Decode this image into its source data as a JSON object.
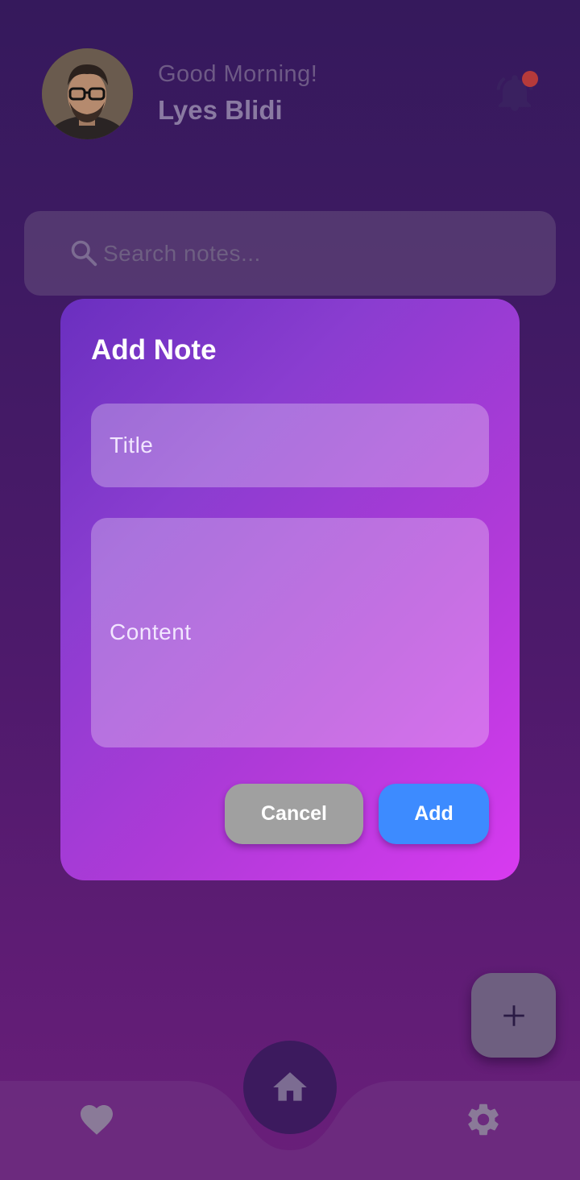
{
  "header": {
    "greeting": "Good Morning!",
    "user_name": "Lyes Blidi",
    "avatar_icon": "avatar-photo",
    "notification_icon": "bell-icon"
  },
  "search": {
    "placeholder": "Search notes...",
    "icon": "search-icon"
  },
  "dialog": {
    "title": "Add Note",
    "title_placeholder": "Title",
    "content_placeholder": "Content",
    "cancel_label": "Cancel",
    "add_label": "Add",
    "colors": {
      "gradient_start": "#6a2fbf",
      "gradient_end": "#d83af0",
      "cancel": "#a0a0a0",
      "add": "#3d8bff"
    }
  },
  "fab": {
    "icon": "plus-icon"
  },
  "bottom_nav": {
    "items": [
      {
        "icon": "heart-icon"
      },
      {
        "icon": "home-icon",
        "active": true
      },
      {
        "icon": "gear-icon"
      }
    ]
  }
}
